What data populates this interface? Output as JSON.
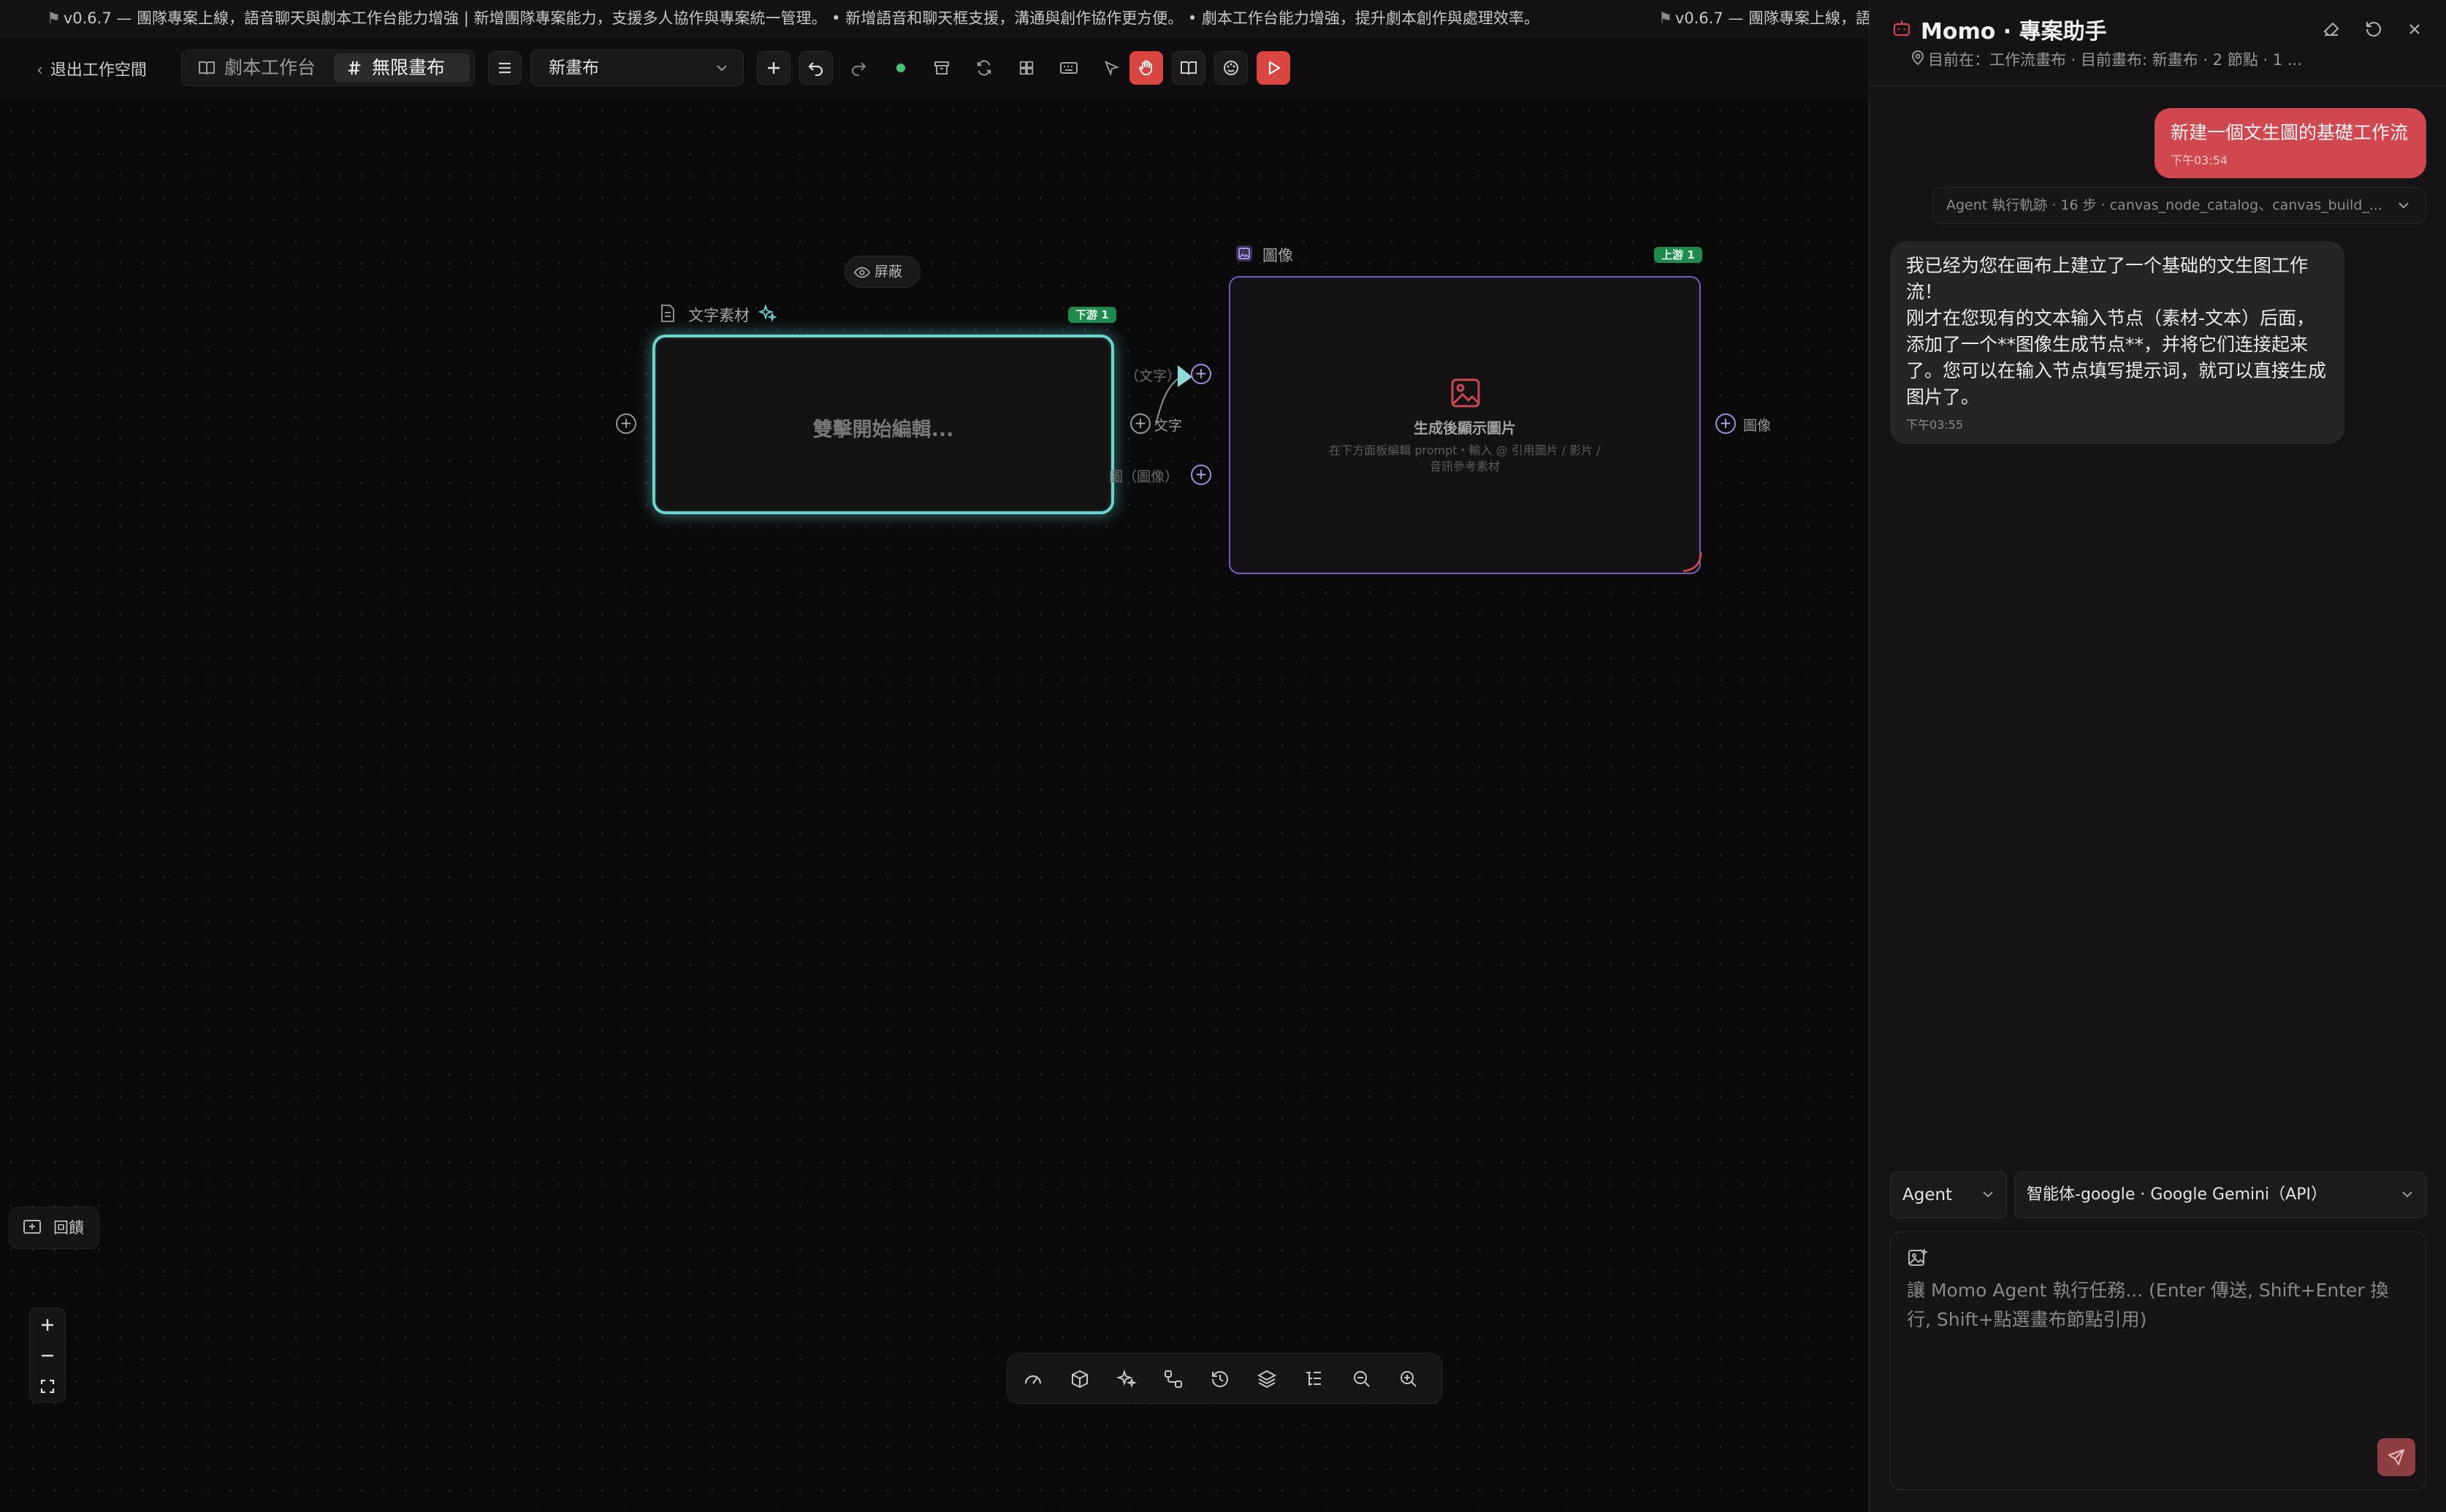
{
  "ticker": {
    "segment_1": "v0.6.7 — 團隊專案上線，語音聊天與劇本工作台能力增強 | 新增團隊專案能力，支援多人協作與專案統一管理。 • 新增語音和聊天框支援，溝通與創作協作更方便。 • 劇本工作台能力增強，提升劇本創作與處理效率。",
    "segment_2": "v0.6.7 — 團隊專案上線，語"
  },
  "toolbar": {
    "exit_label": "退出工作空間",
    "tabs": [
      {
        "label": "劇本工作台",
        "active": false
      },
      {
        "label": "無限畫布",
        "active": true
      }
    ],
    "canvas_select_value": "新畫布"
  },
  "canvas": {
    "shield_pill_label": "屏蔽",
    "text_node": {
      "title": "文字素材",
      "badge": "下游 1",
      "placeholder": "雙擊開始編輯..."
    },
    "image_node": {
      "title": "圖像",
      "badge": "上游 1",
      "heading": "生成後顯示圖片",
      "hint": "在下方面板編輯 prompt・輸入 @ 引用圖片 / 影片 / 音訊參考素材"
    },
    "ports": {
      "text_out_label": "（文字）",
      "text_in_label": "文字",
      "image_in_label": "圖（圖像）",
      "image_out_label": "圖像"
    },
    "feedback_label": "回饋"
  },
  "panel": {
    "title": "Momo · 專案助手",
    "subtitle": "目前在：工作流畫布 · 目前畫布: 新畫布 · 2 節點 · 1 ...",
    "user_message": {
      "text": "新建一個文生圖的基礎工作流",
      "time": "下午03:54"
    },
    "trace": "Agent 執行軌跡 · 16 步 · canvas_node_catalog、canvas_build_...",
    "bot_message": {
      "line1": "我已经为您在画布上建立了一个基础的文生图工作流！",
      "line2": "刚才在您现有的文本输入节点（素材-文本）后面，添加了一个**图像生成节点**，并将它们连接起来了。您可以在输入节点填写提示词，就可以直接生成图片了。",
      "time": "下午03:55"
    },
    "mode_value": "Agent",
    "model_value": "智能体-google · Google Gemini（API）",
    "composer_placeholder": "讓 Momo Agent 執行任務... (Enter 傳送, Shift+Enter 換行, Shift+點選畫布節點引用)"
  },
  "colors": {
    "accent_red": "#d04750",
    "node_cyan": "#6ed4d1",
    "node_violet": "#7a5ac0",
    "badge_green": "#1f8a4c"
  }
}
